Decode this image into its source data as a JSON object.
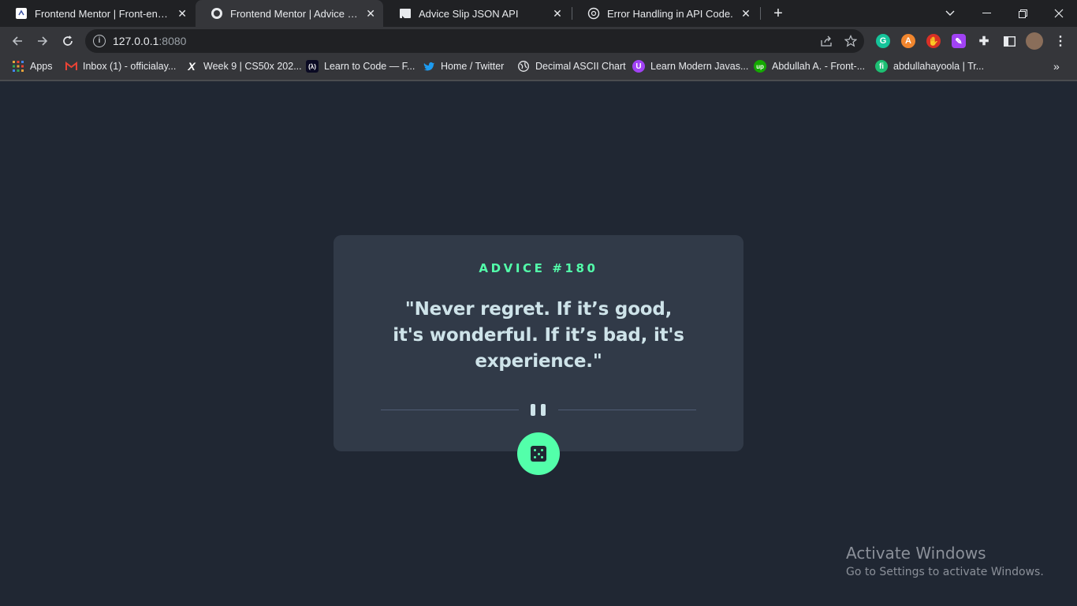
{
  "browser": {
    "tabs": [
      {
        "title": "Frontend Mentor | Front-end coding challenges",
        "icon": "frontend-mentor-icon"
      },
      {
        "title": "Frontend Mentor | Advice generator app",
        "icon": "page-icon"
      },
      {
        "title": "Advice Slip JSON API",
        "icon": "advice-slip-icon"
      },
      {
        "title": "Error Handling in API Code.",
        "icon": "chatgpt-icon"
      }
    ],
    "url_host": "127.0.0.1",
    "url_port": ":8080",
    "bookmarks": [
      {
        "label": "Apps",
        "icon": "apps-grid-icon"
      },
      {
        "label": "Inbox (1) - officialay...",
        "icon": "gmail-icon"
      },
      {
        "label": "Week 9 | CS50x 202...",
        "icon": "x-icon"
      },
      {
        "label": "Learn to Code — F...",
        "icon": "freecodecamp-icon"
      },
      {
        "label": "Home / Twitter",
        "icon": "twitter-icon"
      },
      {
        "label": "Decimal ASCII Chart",
        "icon": "globe-icon"
      },
      {
        "label": "Learn Modern Javas...",
        "icon": "course-icon"
      },
      {
        "label": "Abdullah A. - Front-...",
        "icon": "upwork-icon"
      },
      {
        "label": "abdullahayoola | Tr...",
        "icon": "fiverr-icon"
      }
    ]
  },
  "advice": {
    "id_label": "ADVICE #180",
    "quote": "\"Never regret. If it’s good, it's wonderful. If it’s bad, it's experience.\""
  },
  "watermark": {
    "title": "Activate Windows",
    "subtitle": "Go to Settings to activate Windows."
  },
  "colors": {
    "background": "#202733",
    "card": "#313a48",
    "accent": "#53ffaa",
    "text": "#cee3e9",
    "divider": "#4f5d74"
  }
}
